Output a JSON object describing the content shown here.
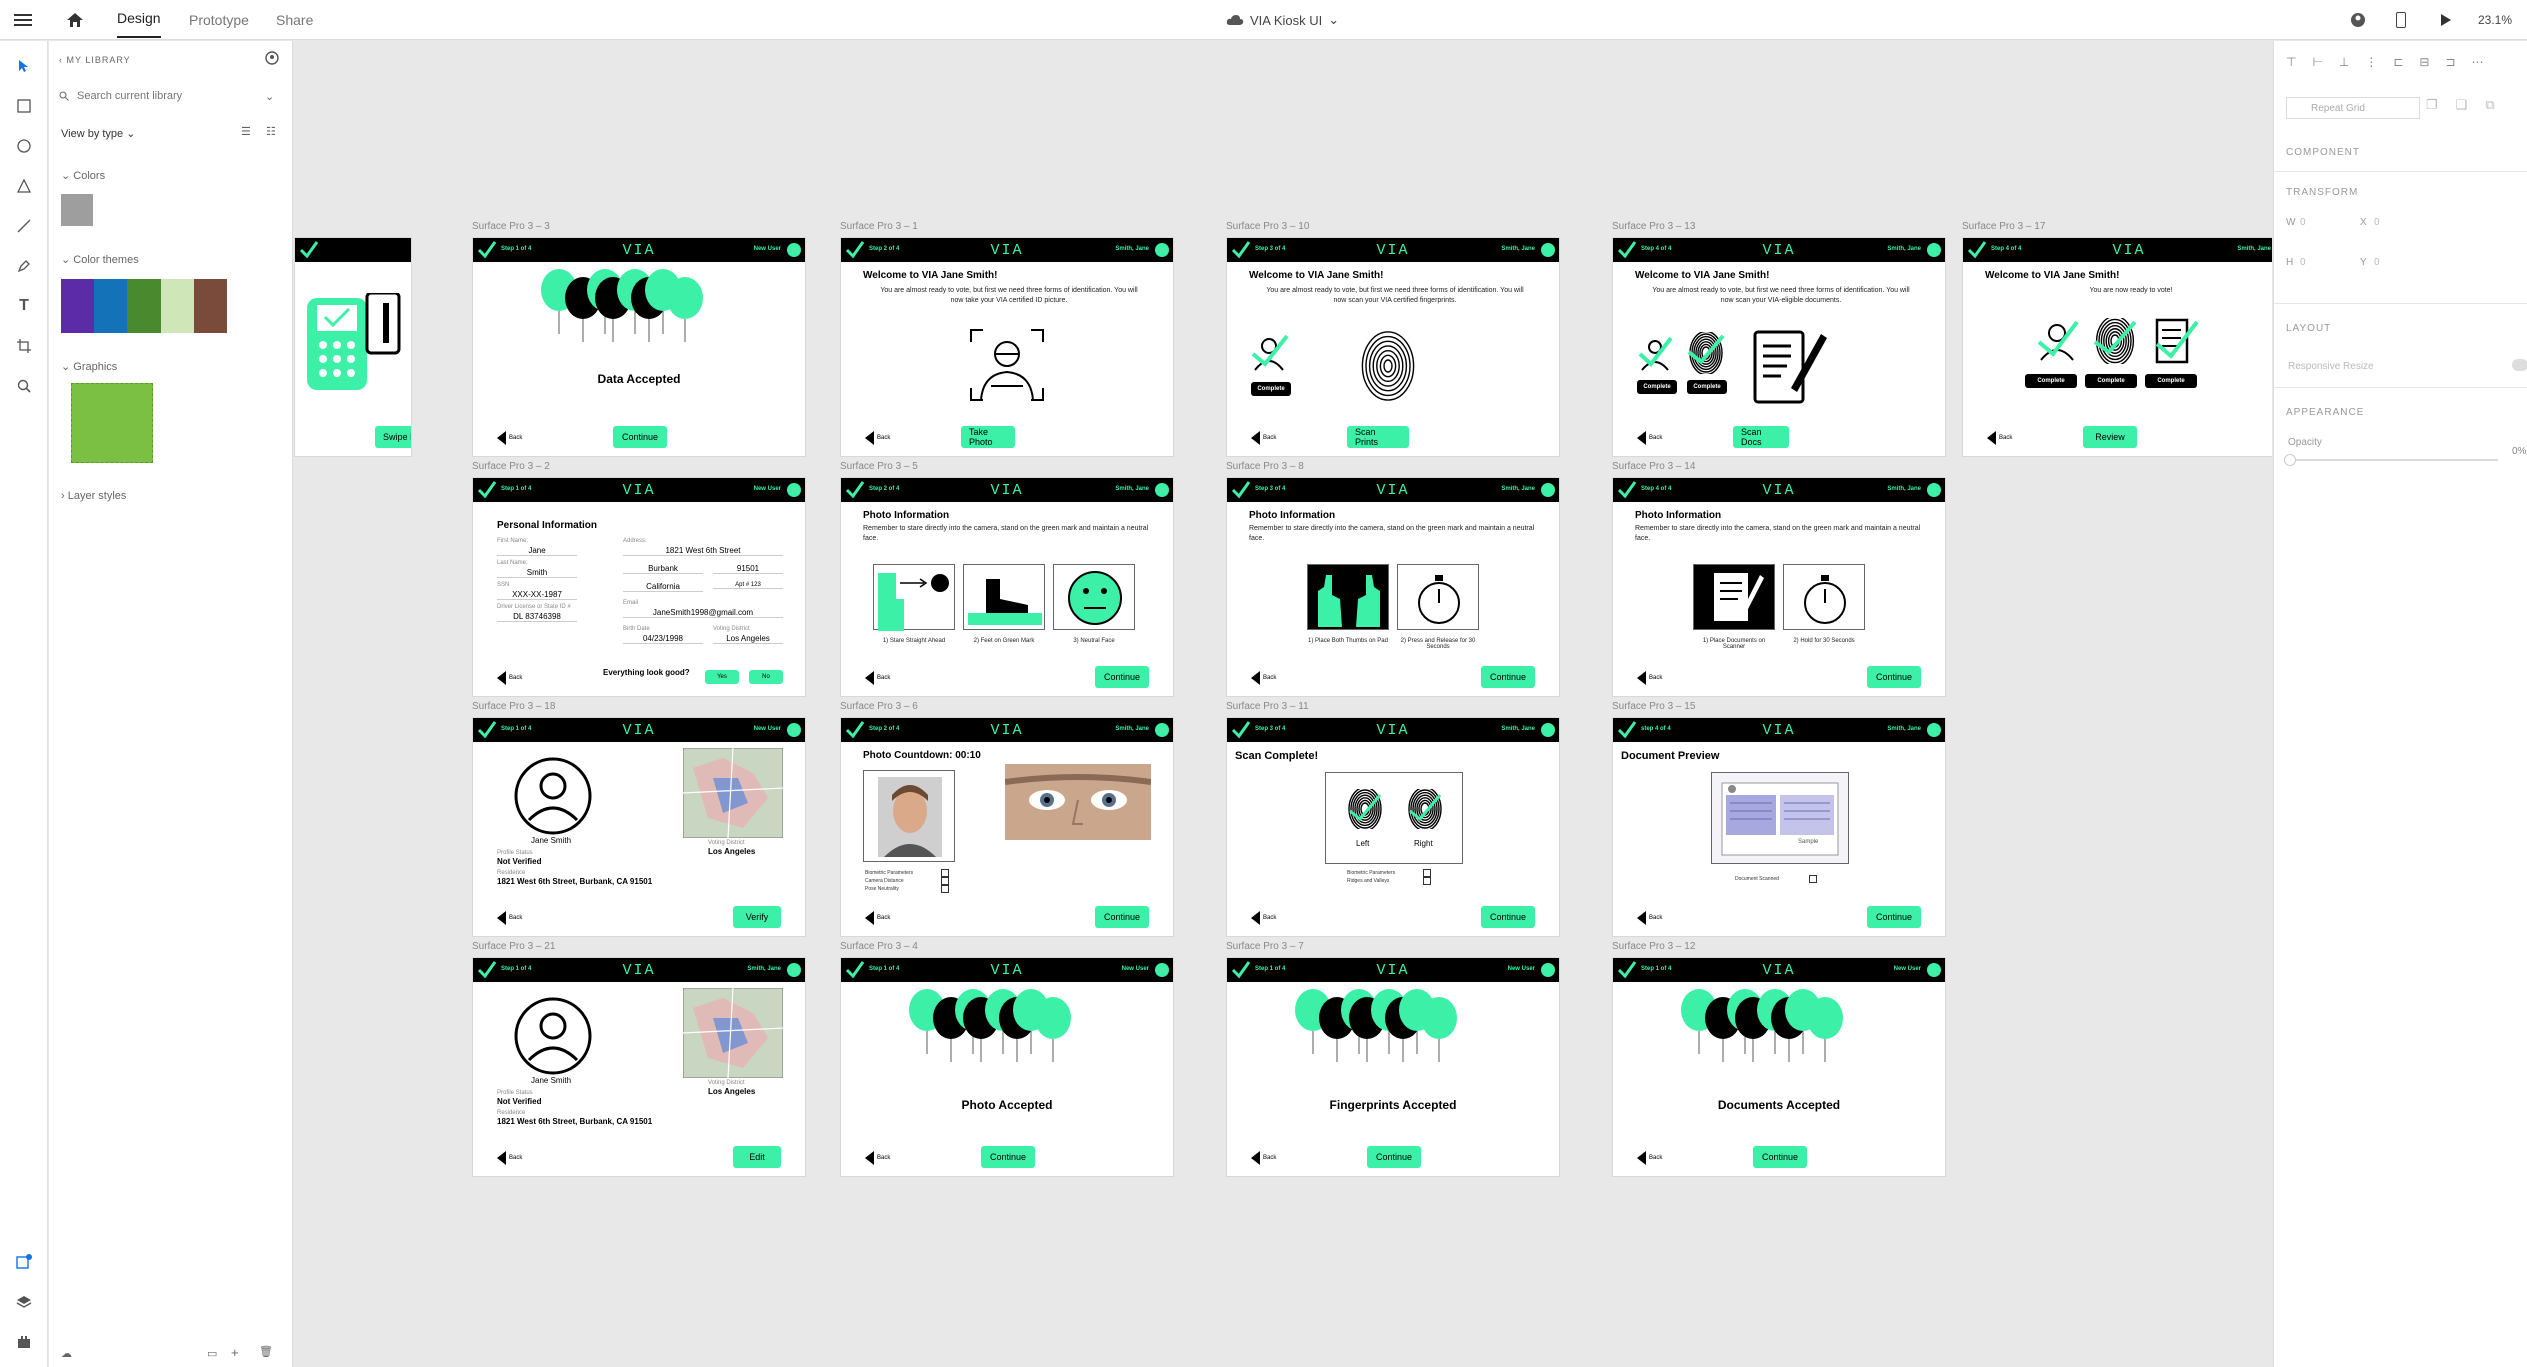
{
  "topbar": {
    "tabs": [
      "Design",
      "Prototype",
      "Share"
    ],
    "doc_title": "VIA Kiosk UI",
    "zoom": "23.1%"
  },
  "library": {
    "header": "MY LIBRARY",
    "search_placeholder": "Search current library",
    "view_by": "View by type",
    "colors_label": "Colors",
    "color_themes_label": "Color themes",
    "graphics_label": "Graphics",
    "layer_styles_label": "Layer styles",
    "colors": [
      "#9e9e9e"
    ],
    "theme": [
      "#5b2ba8",
      "#1472b8",
      "#4a8a2e",
      "#cfe6b8",
      "#7a4a3a"
    ],
    "graphic_color": "#7bc043"
  },
  "props": {
    "repeat_grid": "Repeat Grid",
    "component": "COMPONENT",
    "transform": "TRANSFORM",
    "w": "W",
    "w_val": "0",
    "x": "X",
    "x_val": "0",
    "h": "H",
    "h_val": "0",
    "y": "Y",
    "y_val": "0",
    "layout": "LAYOUT",
    "responsive": "Responsive Resize",
    "appearance": "APPEARANCE",
    "opacity": "Opacity",
    "opacity_val": "0%"
  },
  "common": {
    "via": "VIA",
    "back": "Back",
    "continue": "Continue",
    "complete": "Complete",
    "new_user": "New User",
    "user": "Smith, Jane"
  },
  "artboards": {
    "a3_3": {
      "label": "Surface Pro 3 – 3",
      "step": "Step 1 of 4",
      "title": "Data Accepted"
    },
    "swipe": {
      "btn": "Swipe ID"
    },
    "a3_1": {
      "label": "Surface Pro 3 – 1",
      "step": "Step 2 of 4",
      "title": "Welcome to VIA Jane Smith!",
      "text": "You are almost ready to vote, but first we need three forms of identification. You will now take your VIA certified ID picture.",
      "btn": "Take Photo"
    },
    "a3_10": {
      "label": "Surface Pro 3 – 10",
      "step": "Step 3 of 4",
      "title": "Welcome to VIA Jane Smith!",
      "text": "You are almost ready to vote, but first we need three forms of identification. You will now scan your VIA certified fingerprints.",
      "btn": "Scan Prints"
    },
    "a3_13": {
      "label": "Surface Pro 3 – 13",
      "step": "Step 4 of 4",
      "title": "Welcome to VIA Jane Smith!",
      "text": "You are almost ready to vote, but first we need three forms of identification. You will now scan your VIA-eligible documents.",
      "btn": "Scan Docs"
    },
    "a3_17": {
      "label": "Surface Pro 3 – 17",
      "step": "Step 4 of 4",
      "title": "Welcome to VIA Jane Smith!",
      "text": "You are now ready to vote!",
      "btn": "Review"
    },
    "a3_2": {
      "label": "Surface Pro 3 – 2",
      "step": "Step 1 of 4",
      "title": "Personal Information",
      "first_l": "First Name:",
      "first": "Jane",
      "last_l": "Last Name:",
      "last": "Smith",
      "ssn_l": "SSN",
      "ssn": "XXX-XX-1987",
      "dl_l": "Driver License or State ID #",
      "dl": "DL 83746398",
      "addr_l": "Address:",
      "addr": "1821 West 6th Street",
      "city": "Burbank",
      "zip": "91501",
      "state": "California",
      "apt": "Apt # 123",
      "email_l": "Email",
      "email": "JaneSmith1998@gmail.com",
      "bd_l": "Birth Date",
      "bd": "04/23/1998",
      "vd_l": "Voting District",
      "vd": "Los Angeles",
      "q": "Everything look good?",
      "yes": "Yes",
      "no": "No"
    },
    "a3_5": {
      "label": "Surface Pro 3 – 5",
      "step": "Step 2 of 4",
      "title": "Photo Information",
      "text": "Remember to stare directly into the camera, stand on the green mark and maintain a neutral face.",
      "c1": "1) Stare Straight Ahead",
      "c2": "2) Feet on Green Mark",
      "c3": "3) Neutral Face"
    },
    "a3_8": {
      "label": "Surface Pro 3 – 8",
      "step": "Step 3 of 4",
      "title": "Photo Information",
      "text": "Remember to stare directly into the camera, stand on the green mark and maintain a neutral face.",
      "c1": "1) Place Both Thumbs on Pad",
      "c2": "2) Press and Release for 30 Seconds"
    },
    "a3_14": {
      "label": "Surface Pro 3 – 14",
      "step": "Step 4 of 4",
      "title": "Photo Information",
      "text": "Remember to stare directly into the camera, stand on the green mark and maintain a neutral face.",
      "c1": "1) Place Documents on Scanner",
      "c2": "2) Hold for 30 Seconds"
    },
    "a3_18": {
      "label": "Surface Pro 3 – 18",
      "step": "Step 1 of 4",
      "name": "Jane Smith",
      "ps_l": "Profile Status",
      "ps": "Not Verified",
      "res_l": "Residence",
      "res": "1821 West 6th Street, Burbank, CA 91501",
      "vd_l": "Voting District",
      "vd": "Los Angeles",
      "btn": "Verify"
    },
    "a3_6": {
      "label": "Surface Pro 3 – 6",
      "step": "Step 2 of 4",
      "title": "Photo Countdown: 00:10",
      "p1": "Biometric Parameters",
      "p2": "Camera Distance",
      "p3": "Pose Neutrality"
    },
    "a3_11": {
      "label": "Surface Pro 3 – 11",
      "step": "Step 3 of 4",
      "title": "Scan Complete!",
      "left": "Left",
      "right": "Right",
      "p1": "Biometric Parameters",
      "p2": "Ridges and Valleys"
    },
    "a3_15": {
      "label": "Surface Pro 3 – 15",
      "step": "step 4 of 4",
      "title": "Document Preview",
      "p1": "Document Scanned",
      "sample": "Sample"
    },
    "a3_21": {
      "label": "Surface Pro 3 – 21",
      "step": "Step 1 of 4",
      "name": "Jane Smith",
      "ps_l": "Profile Status",
      "ps": "Not Verified",
      "res_l": "Residence",
      "res": "1821 West 6th Street, Burbank, CA 91501",
      "vd_l": "Voting District",
      "vd": "Los Angeles",
      "btn": "Edit"
    },
    "a3_4": {
      "label": "Surface Pro 3 – 4",
      "step": "Step 1 of 4",
      "title": "Photo Accepted"
    },
    "a3_7": {
      "label": "Surface Pro 3 – 7",
      "step": "Step 1 of 4",
      "title": "Fingerprints Accepted"
    },
    "a3_12": {
      "label": "Surface Pro 3 – 12",
      "step": "Step 1 of 4",
      "title": "Documents Accepted"
    }
  }
}
